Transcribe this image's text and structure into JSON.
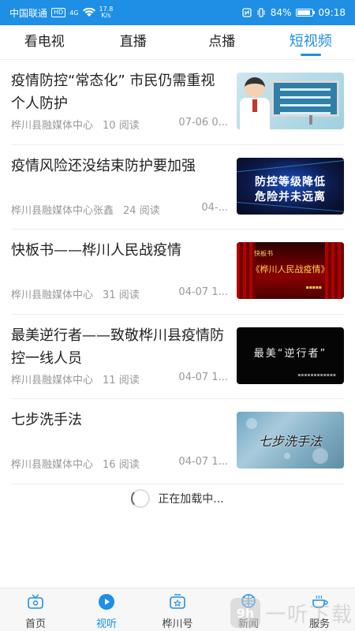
{
  "status_bar": {
    "carrier": "中国联通",
    "hd_badge": "HD",
    "network_type": "4G",
    "speed_value": "17.8",
    "speed_unit": "K/s",
    "battery_text": "84%",
    "battery_level": 0.84,
    "time": "09:18"
  },
  "tabs": [
    {
      "label": "看电视",
      "active": false
    },
    {
      "label": "直播",
      "active": false
    },
    {
      "label": "点播",
      "active": false
    },
    {
      "label": "短视频",
      "active": true
    }
  ],
  "feed": [
    {
      "title": "疫情防控“常态化” 市民仍需重视个人防护",
      "source": "桦川县融媒体中心",
      "reads": "10 阅读",
      "date": "07-06 0..."
    },
    {
      "title": "疫情风险还没结束防护要加强",
      "source": "桦川县融媒体中心张鑫",
      "reads": "24 阅读",
      "date": "04-...",
      "thumb_lines": [
        "防控等级降低",
        "危险并未远离"
      ]
    },
    {
      "title": "快板书——桦川人民战疫情",
      "source": "桦川县融媒体中心",
      "reads": "31 阅读",
      "date": "04-07 1...",
      "thumb_tag": "快板书",
      "thumb_label": "《桦川人民战疫情》"
    },
    {
      "title": "最美逆行者——致敬桦川县疫情防控一线人员",
      "source": "桦川县融媒体中心",
      "reads": "11 阅读",
      "date": "04-07 1...",
      "thumb_label": "最美“逆行者”"
    },
    {
      "title": "七步洗手法",
      "source": "桦川县融媒体中心",
      "reads": "16 阅读",
      "date": "04-07 1...",
      "thumb_label": "七步洗手法"
    }
  ],
  "loading_text": "正在加载中...",
  "bottom_nav": [
    {
      "label": "首页",
      "icon": "home-tv-icon",
      "active": false
    },
    {
      "label": "视听",
      "icon": "play-icon",
      "active": true
    },
    {
      "label": "桦川号",
      "icon": "account-icon",
      "active": false
    },
    {
      "label": "新闻",
      "icon": "news-icon",
      "active": false
    },
    {
      "label": "服务",
      "icon": "service-icon",
      "active": false
    }
  ],
  "watermark": {
    "logo": "9h",
    "text": "一听下载"
  },
  "colors": {
    "accent": "#1e8fe5",
    "status_bar": "#1e8fe5"
  }
}
